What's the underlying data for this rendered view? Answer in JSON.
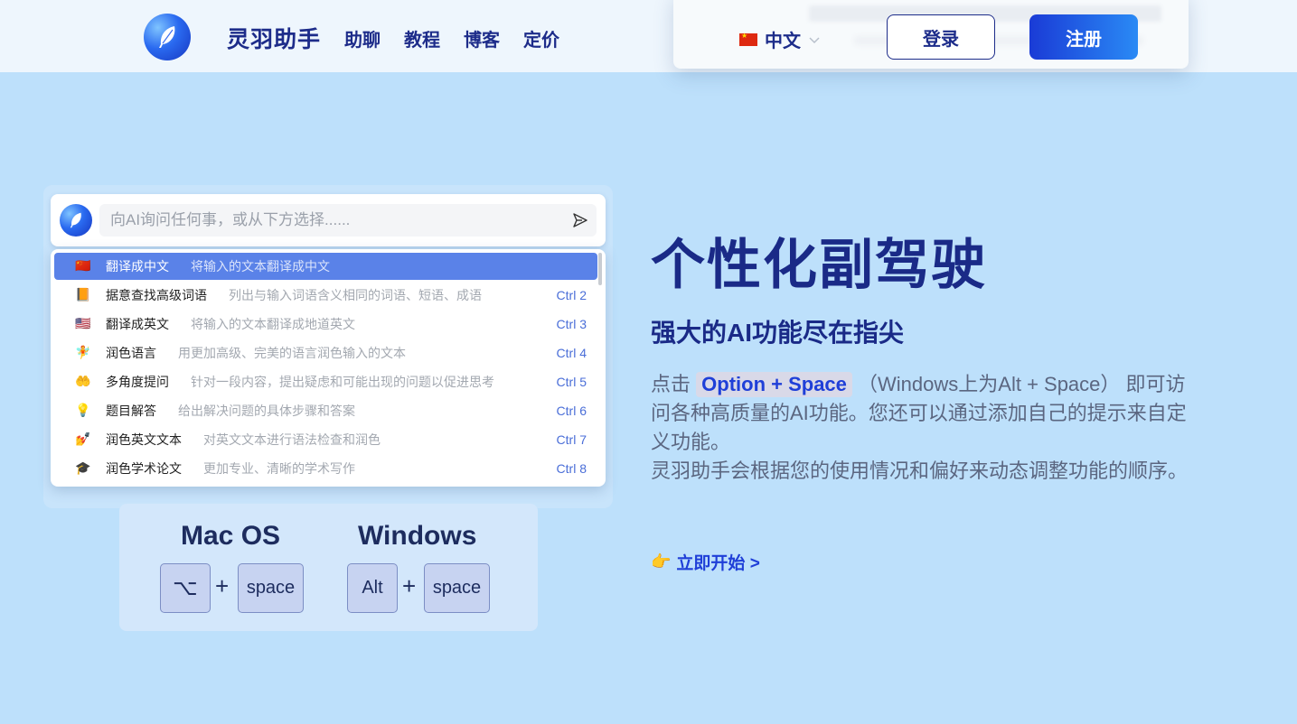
{
  "header": {
    "brand": "灵羽助手",
    "nav": [
      "助聊",
      "教程",
      "博客",
      "定价"
    ],
    "language": "中文",
    "login_label": "登录",
    "register_label": "注册"
  },
  "palette": {
    "placeholder": "向AI询问任何事，或从下方选择......",
    "commands": [
      {
        "icon": "🇨🇳",
        "name": "翻译成中文",
        "desc": "将输入的文本翻译成中文",
        "shortcut": ""
      },
      {
        "icon": "📙",
        "name": "据意查找高级词语",
        "desc": "列出与输入词语含义相同的词语、短语、成语",
        "shortcut": "Ctrl 2"
      },
      {
        "icon": "🇺🇸",
        "name": "翻译成英文",
        "desc": "将输入的文本翻译成地道英文",
        "shortcut": "Ctrl 3"
      },
      {
        "icon": "🧚",
        "name": "润色语言",
        "desc": "用更加高级、完美的语言润色输入的文本",
        "shortcut": "Ctrl 4"
      },
      {
        "icon": "🤲",
        "name": "多角度提问",
        "desc": "针对一段内容，提出疑虑和可能出现的问题以促进思考",
        "shortcut": "Ctrl 5"
      },
      {
        "icon": "💡",
        "name": "题目解答",
        "desc": "给出解决问题的具体步骤和答案",
        "shortcut": "Ctrl 6"
      },
      {
        "icon": "💅",
        "name": "润色英文文本",
        "desc": "对英文文本进行语法检查和润色",
        "shortcut": "Ctrl 7"
      },
      {
        "icon": "🎓",
        "name": "润色学术论文",
        "desc": "更加专业、清晰的学术写作",
        "shortcut": "Ctrl 8"
      }
    ]
  },
  "shortcuts": {
    "mac_title": "Mac OS",
    "mac_key1": "⌥",
    "mac_key2": "space",
    "win_title": "Windows",
    "win_key1": "Alt",
    "win_key2": "space",
    "plus": "+"
  },
  "hero": {
    "title": "个性化副驾驶",
    "subtitle": "强大的AI功能尽在指尖",
    "body_prefix": "点击",
    "body_key": "Option + Space",
    "body_rest": "（Windows上为Alt + Space） 即可访问各种高质量的AI功能。您还可以通过添加自己的提示来自定义功能。",
    "body_line2": "灵羽助手会根据您的使用情况和偏好来动态调整功能的顺序。",
    "cta_icon": "👉",
    "cta_label": "立即开始 >"
  },
  "colors": {
    "background": "#bde0fb",
    "primary": "#1a2a87",
    "accent": "#1f3fd8",
    "active_row": "#5a82e8"
  }
}
